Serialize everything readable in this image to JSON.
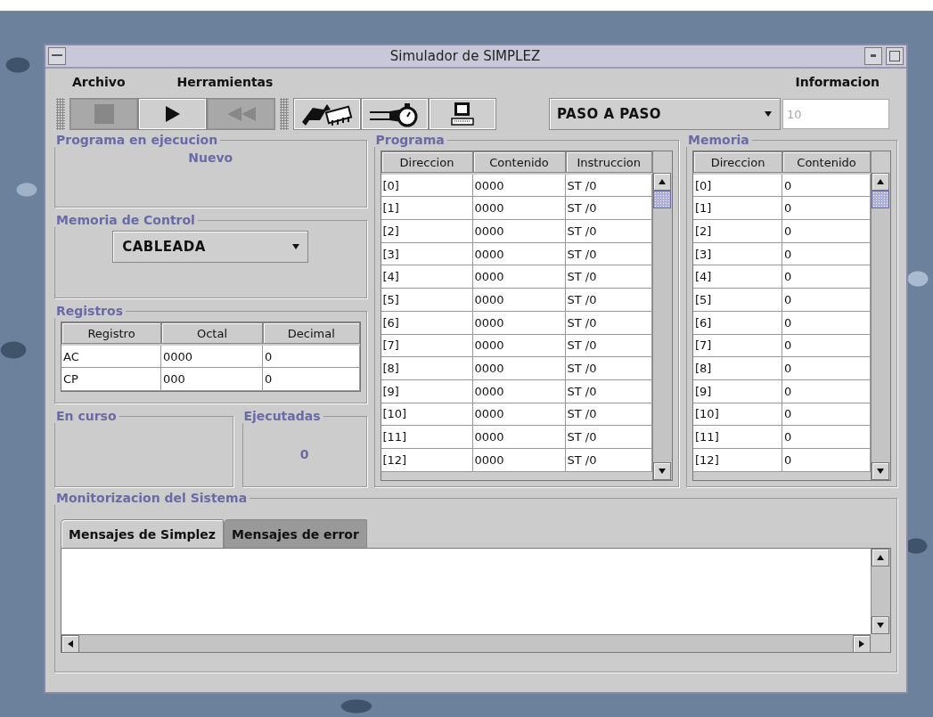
{
  "window": {
    "title": "Simulador de SIMPLEZ"
  },
  "menu": {
    "left": [
      "Archivo",
      "Herramientas"
    ],
    "right": [
      "Informacion"
    ]
  },
  "toolbar": {
    "playback": [
      {
        "kind": "stop",
        "disabled": true
      },
      {
        "kind": "play",
        "disabled": false
      },
      {
        "kind": "rewind",
        "disabled": true
      }
    ],
    "tools": [
      {
        "kind": "chip"
      },
      {
        "kind": "stopwatch"
      },
      {
        "kind": "computer"
      }
    ],
    "mode": {
      "value": "PASO A PASO"
    },
    "steps": {
      "value": "10",
      "disabled": true
    }
  },
  "program_running": {
    "title": "Programa en ejecucion",
    "value": "Nuevo"
  },
  "control_memory": {
    "title": "Memoria de Control",
    "value": "CABLEADA"
  },
  "registers": {
    "title": "Registros",
    "columns": [
      "Registro",
      "Octal",
      "Decimal"
    ],
    "rows": [
      [
        "AC",
        "0000",
        "0"
      ],
      [
        "CP",
        "000",
        "0"
      ]
    ]
  },
  "in_progress": {
    "title": "En curso"
  },
  "executed": {
    "title": "Ejecutadas",
    "value": "0"
  },
  "program": {
    "title": "Programa",
    "columns": [
      "Direccion",
      "Contenido",
      "Instruccion"
    ],
    "rows": [
      [
        "[0]",
        "0000",
        "ST /0"
      ],
      [
        "[1]",
        "0000",
        "ST /0"
      ],
      [
        "[2]",
        "0000",
        "ST /0"
      ],
      [
        "[3]",
        "0000",
        "ST /0"
      ],
      [
        "[4]",
        "0000",
        "ST /0"
      ],
      [
        "[5]",
        "0000",
        "ST /0"
      ],
      [
        "[6]",
        "0000",
        "ST /0"
      ],
      [
        "[7]",
        "0000",
        "ST /0"
      ],
      [
        "[8]",
        "0000",
        "ST /0"
      ],
      [
        "[9]",
        "0000",
        "ST /0"
      ],
      [
        "[10]",
        "0000",
        "ST /0"
      ],
      [
        "[11]",
        "0000",
        "ST /0"
      ],
      [
        "[12]",
        "0000",
        "ST /0"
      ]
    ]
  },
  "memory": {
    "title": "Memoria",
    "columns": [
      "Direccion",
      "Contenido"
    ],
    "rows": [
      [
        "[0]",
        "0"
      ],
      [
        "[1]",
        "0"
      ],
      [
        "[2]",
        "0"
      ],
      [
        "[3]",
        "0"
      ],
      [
        "[4]",
        "0"
      ],
      [
        "[5]",
        "0"
      ],
      [
        "[6]",
        "0"
      ],
      [
        "[7]",
        "0"
      ],
      [
        "[8]",
        "0"
      ],
      [
        "[9]",
        "0"
      ],
      [
        "[10]",
        "0"
      ],
      [
        "[11]",
        "0"
      ],
      [
        "[12]",
        "0"
      ]
    ]
  },
  "monitoring": {
    "title": "Monitorizacion del Sistema",
    "tabs": [
      {
        "label": "Mensajes de Simplez",
        "selected": true
      },
      {
        "label": "Mensajes de error",
        "selected": false
      }
    ]
  }
}
